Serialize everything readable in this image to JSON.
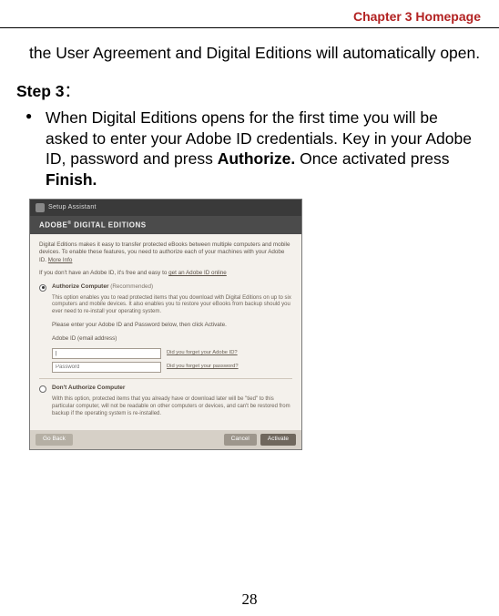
{
  "header": {
    "title": "Chapter 3 Homepage"
  },
  "lead": "the User Agreement and Digital Editions will automatically open.",
  "step": {
    "label": "Step 3",
    "colon": "："
  },
  "bullet1_a": "When Digital Editions opens for the first time you will be asked to enter your Adobe ID credentials. Key in your Adobe ID, password and press ",
  "bullet1_auth": "Authorize.",
  "bullet1_b": " Once activated press ",
  "bullet1_finish": "Finish.",
  "shot": {
    "logo": "ADOBE",
    "logo_sup": "®",
    "logo_tail": " DIGITAL EDITIONS",
    "intro_a": "Digital Editions makes it easy to transfer protected eBooks between multiple computers and mobile devices. To enable these features, you need to authorize each of your machines with your Adobe ID. ",
    "intro_more": "More Info",
    "noacct_a": "If you don't have an Adobe ID, it's free and easy to ",
    "noacct_link": "get an Adobe ID online",
    "opt1_title": "Authorize Computer",
    "opt1_rec": "(Recommended)",
    "opt1_desc": "This option enables you to read protected items that you download with Digital Editions on up to six computers and mobile devices. It also enables you to restore your eBooks from backup should you ever need to re-install your operating system.",
    "enter_label": "Please enter your Adobe ID and Password below, then click Activate.",
    "id_label": "Adobe ID (email address)",
    "pwd_label": "Password",
    "forgot_id": "Did you forget your Adobe ID?",
    "forgot_pwd": "Did you forget your password?",
    "opt2_title": "Don't Authorize Computer",
    "opt2_desc": "With this option, protected items that you already have or download later will be \"tied\" to this particular computer, will not be readable on other computers or devices, and can't be restored from backup if the operating system is re-installed.",
    "btn_back": "Go Back",
    "btn_cancel": "Cancel",
    "btn_activate": "Activate"
  },
  "page_number": "28"
}
